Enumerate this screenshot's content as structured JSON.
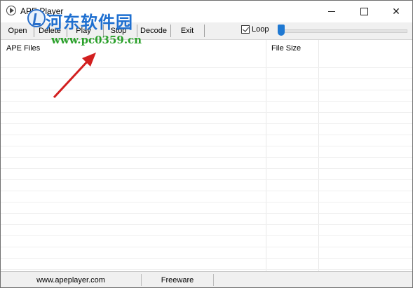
{
  "window": {
    "title": "APE Player"
  },
  "toolbar": {
    "open": "Open",
    "delete": "Delete",
    "play": "Play",
    "stop": "Stop",
    "decode": "Decode",
    "exit": "Exit",
    "loop_label": "Loop",
    "loop_checked": true
  },
  "list": {
    "columns": [
      "APE Files",
      "File Size"
    ],
    "rows": []
  },
  "status": {
    "website": "www.apeplayer.com",
    "license": "Freeware"
  },
  "watermark": {
    "title": "河东软件园",
    "url": "www.pc0359.cn"
  },
  "colors": {
    "accent": "#1e78d2",
    "arrow": "#d21f1f",
    "watermark_title": "#1e6fd0",
    "watermark_url": "#2aa02a"
  }
}
